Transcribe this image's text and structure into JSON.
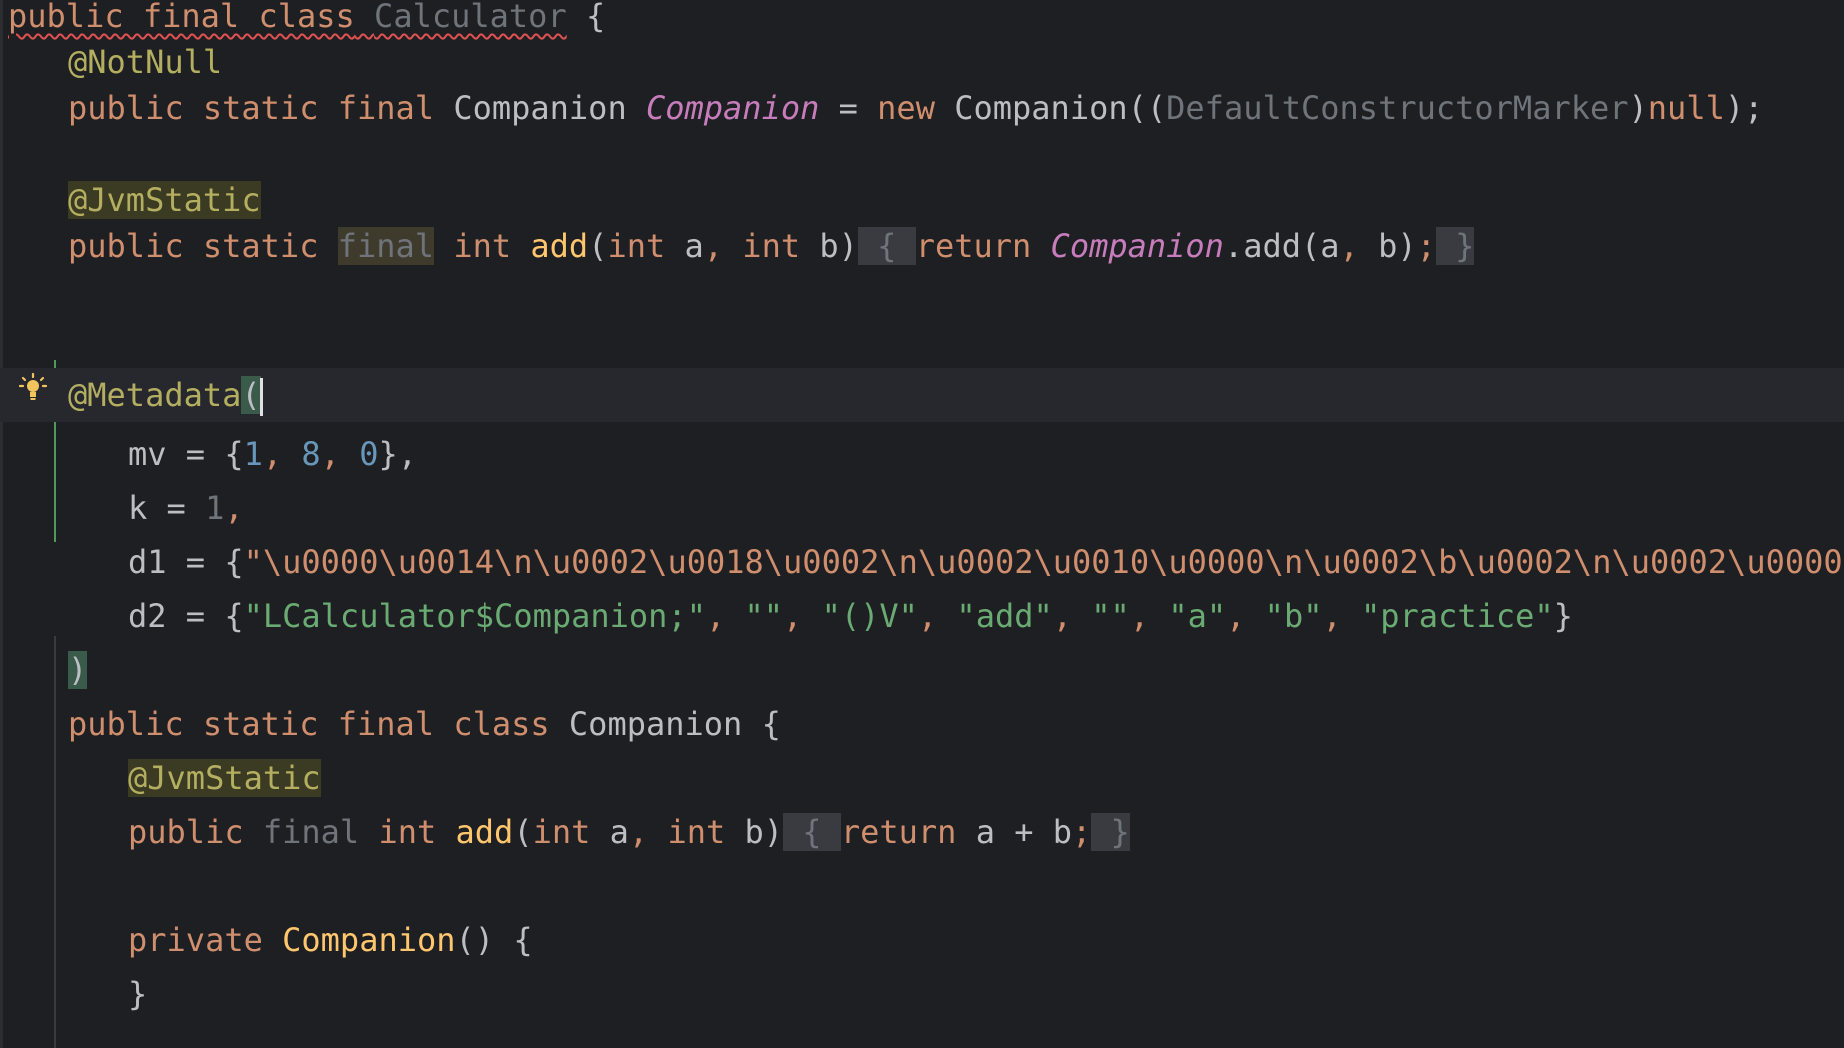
{
  "editor": {
    "lines": {
      "l1": {
        "public_final_class": "public final class",
        "class_name": "Calculator",
        "brace": " {"
      },
      "l2": {
        "annotation": "@NotNull"
      },
      "l3": {
        "modifiers": "public static final ",
        "type": "Companion",
        "field": "Companion",
        "eq": " = ",
        "new_kw": "new ",
        "ctor": "Companion((",
        "marker": "DefaultConstructorMarker",
        "close": ")",
        "null_kw": "null",
        "tail": ");"
      },
      "l5": {
        "annotation": "@JvmStatic"
      },
      "l6": {
        "mods": "public static ",
        "final_kw": "final",
        "int_kw": " int ",
        "fn": "add",
        "params_open": "(",
        "int_a": "int",
        "a": " a",
        "comma1": ", ",
        "int_b": "int",
        "b": " b)",
        "brace_open": " { ",
        "return_kw": "return ",
        "field": "Companion",
        "call": ".add(a",
        "comma2": ", ",
        "b2": "b)",
        "semi": ";",
        "brace_close": " }"
      },
      "l8": {
        "annotation": "@Metadata",
        "paren": "("
      },
      "l9": {
        "key": "mv = {",
        "n1": "1",
        "c1": ", ",
        "n2": "8",
        "c2": ", ",
        "n3": "0",
        "end": "},"
      },
      "l10": {
        "key": "k = ",
        "n": "1",
        "end": ","
      },
      "l11": {
        "key": "d1 = {",
        "value": "\"\\u0000\\u0014\\n\\u0002\\u0018\\u0002\\n\\u0002\\u0010\\u0000\\n\\u0002\\b\\u0002\\n\\u0002\\u0000"
      },
      "l12": {
        "key": "d2 = {",
        "s1": "\"LCalculator$Companion;\"",
        "c": ", ",
        "s2": "\"\"",
        "s3": "\"()V\"",
        "s4": "\"add\"",
        "s5": "\"\"",
        "s6": "\"a\"",
        "s7": "\"b\"",
        "s8": "\"practice\"",
        "end": "}"
      },
      "l13": {
        "paren": ")"
      },
      "l14": {
        "mods": "public static final class ",
        "name": "Companion",
        "brace": " {"
      },
      "l15": {
        "annotation": "@JvmStatic"
      },
      "l16": {
        "public_kw": "public ",
        "final_kw": "final",
        "int_kw": " int ",
        "fn": "add",
        "params": "(",
        "int_a": "int",
        "a": " a",
        "comma": ", ",
        "int_b": "int",
        "b": " b)",
        "brace_open": " { ",
        "return_kw": "return ",
        "expr": "a + b",
        "semi": ";",
        "brace_close": " }"
      },
      "l18": {
        "private_kw": "private ",
        "name": "Companion",
        "parens": "() {"
      },
      "l19": {
        "brace": "}"
      }
    },
    "icons": {
      "intention": "lightbulb-icon"
    },
    "colors": {
      "background": "#1e1f22",
      "keyword": "#cf8e6d",
      "annotation": "#b3ae60",
      "string": "#6aab73",
      "number": "#6897bb",
      "field": "#c77dbb",
      "function": "#ffc66d"
    }
  }
}
